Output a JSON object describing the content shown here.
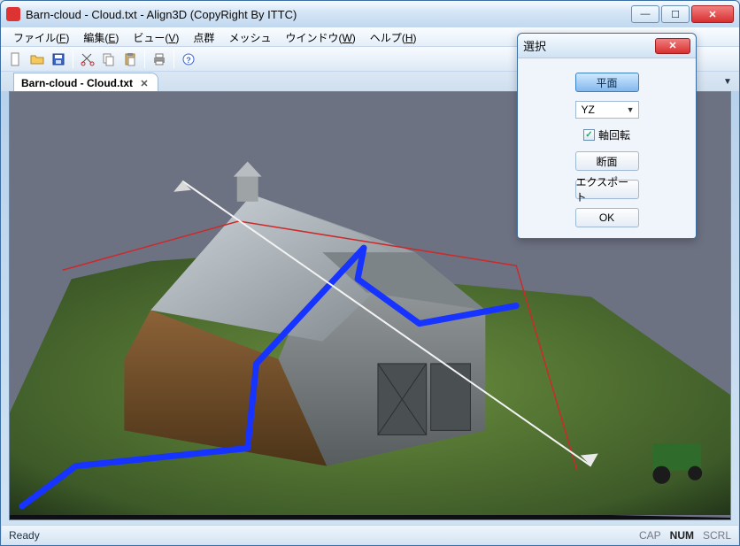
{
  "window": {
    "title": "Barn-cloud - Cloud.txt - Align3D (CopyRight By ITTC)"
  },
  "menu": {
    "file": {
      "label": "ファイル",
      "accel": "F"
    },
    "edit": {
      "label": "編集",
      "accel": "E"
    },
    "view": {
      "label": "ビュー",
      "accel": "V"
    },
    "points": {
      "label": "点群",
      "accel": ""
    },
    "mesh": {
      "label": "メッシュ",
      "accel": ""
    },
    "winm": {
      "label": "ウインドウ",
      "accel": "W"
    },
    "help": {
      "label": "ヘルプ",
      "accel": "H"
    }
  },
  "toolbar": {
    "newfile": "new",
    "open": "open",
    "save": "save",
    "cut": "cut",
    "copy": "copy",
    "paste": "paste",
    "print": "print",
    "help": "help"
  },
  "tab": {
    "label": "Barn-cloud - Cloud.txt"
  },
  "dialog": {
    "title": "選択",
    "plane_btn": "平面",
    "axis_value": "YZ",
    "rotate_label": "軸回転",
    "section_btn": "断面",
    "export_btn": "エクスポート",
    "ok_btn": "OK"
  },
  "status": {
    "ready": "Ready",
    "cap": "CAP",
    "num": "NUM",
    "scrl": "SCRL"
  }
}
